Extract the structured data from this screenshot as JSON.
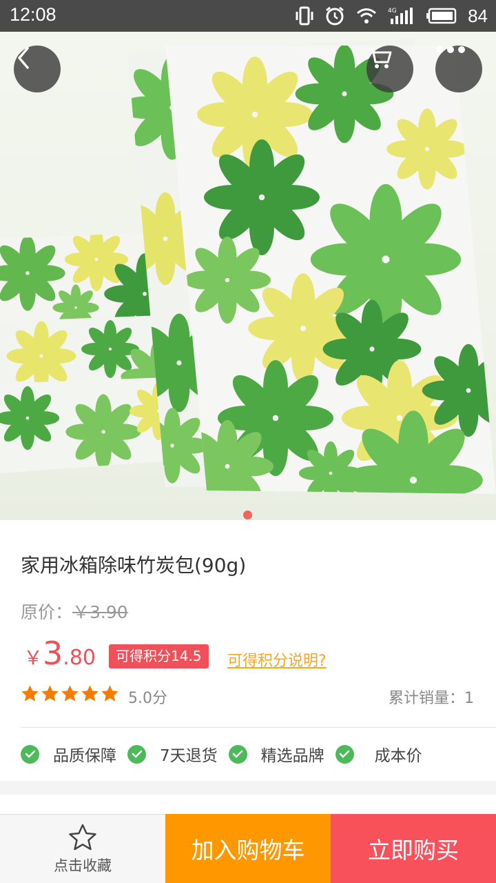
{
  "status_bar": {
    "time": "12:08",
    "battery": "84"
  },
  "product": {
    "title": "家用冰箱除味竹炭包(90g)",
    "original_price_label": "原价：",
    "original_price": "￥3.90",
    "price_currency": "￥",
    "price_integer": "3",
    "price_decimal": ".80",
    "points_badge": "可得积分14.5",
    "points_link": "可得积分说明?",
    "rating": 5,
    "score": "5.0分",
    "sales": "累计销量：1",
    "image_count": 1,
    "current_image": 1
  },
  "guarantees": [
    {
      "label": "品质保障"
    },
    {
      "label": "7天退货"
    },
    {
      "label": "精选品牌"
    },
    {
      "label": "成本价"
    }
  ],
  "bottom_bar": {
    "favorite_label": "点击收藏",
    "add_cart_label": "加入购物车",
    "buy_now_label": "立即购买"
  },
  "colors": {
    "accent_red": "#f0505a",
    "orange": "#ff9800",
    "star": "#f57c00",
    "check_green": "#4cba58",
    "link_orange": "#f5a623"
  }
}
